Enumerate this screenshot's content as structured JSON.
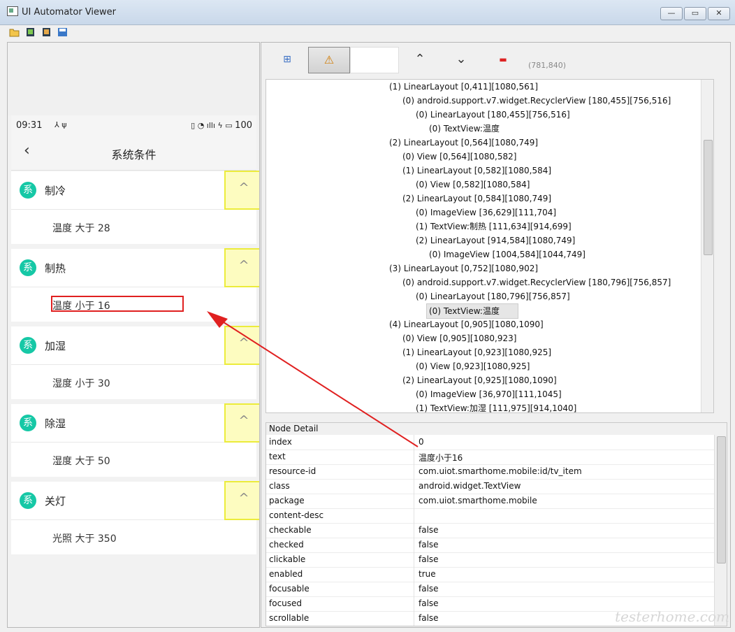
{
  "window": {
    "title": "UI Automator Viewer",
    "minimize": "—",
    "maximize": "▭",
    "close": "✕"
  },
  "toolbar": {
    "icons": [
      "open-folder-icon",
      "device-screenshot-icon",
      "device-screenshot-compressed-icon",
      "save-icon"
    ]
  },
  "phone": {
    "status_time": "09:31",
    "status_icons": "⅄ ψ",
    "status_right": "▯ ◔ ıllı ϟ ▭",
    "battery": "100",
    "back": "‹",
    "page_title": "系统条件",
    "cards": [
      {
        "badge": "系",
        "title": "制冷",
        "body": "温度 大于 28"
      },
      {
        "badge": "系",
        "title": "制热",
        "body": "温度 小于 16"
      },
      {
        "badge": "系",
        "title": "加湿",
        "body": "湿度 小于 30"
      },
      {
        "badge": "系",
        "title": "除湿",
        "body": "湿度 大于 50"
      },
      {
        "badge": "系",
        "title": "关灯",
        "body": "光照 大于 350"
      }
    ],
    "expand_glyph": "^"
  },
  "right": {
    "coords": "(781,840)",
    "tools": {
      "expand": "⊞",
      "warn": "⚠",
      "up": "⌃",
      "down": "⌄",
      "minus": "▬"
    },
    "tree": [
      "(1) LinearLayout [0,411][1080,561]",
      "(0) android.support.v7.widget.RecyclerView [180,455][756,516]",
      "(0) LinearLayout [180,455][756,516]",
      "(0) TextView:温度",
      "(2) LinearLayout [0,564][1080,749]",
      "(0) View [0,564][1080,582]",
      "(1) LinearLayout [0,582][1080,584]",
      "(0) View [0,582][1080,584]",
      "(2) LinearLayout [0,584][1080,749]",
      "(0) ImageView [36,629][111,704]",
      "(1) TextView:制热 [111,634][914,699]",
      "(2) LinearLayout [914,584][1080,749]",
      "(0) ImageView [1004,584][1044,749]",
      "(3) LinearLayout [0,752][1080,902]",
      "(0) android.support.v7.widget.RecyclerView [180,796][756,857]",
      "(0) LinearLayout [180,796][756,857]",
      "(0) TextView:温度",
      "(4) LinearLayout [0,905][1080,1090]",
      "(0) View [0,905][1080,923]",
      "(1) LinearLayout [0,923][1080,925]",
      "(0) View [0,923][1080,925]",
      "(2) LinearLayout [0,925][1080,1090]",
      "(0) ImageView [36,970][111,1045]",
      "(1) TextView:加湿 [111,975][914,1040]"
    ],
    "detail_title": "Node Detail",
    "detail": [
      {
        "key": "index",
        "value": "0"
      },
      {
        "key": "text",
        "value": "温度小于16"
      },
      {
        "key": "resource-id",
        "value": "com.uiot.smarthome.mobile:id/tv_item"
      },
      {
        "key": "class",
        "value": "android.widget.TextView"
      },
      {
        "key": "package",
        "value": "com.uiot.smarthome.mobile"
      },
      {
        "key": "content-desc",
        "value": ""
      },
      {
        "key": "checkable",
        "value": "false"
      },
      {
        "key": "checked",
        "value": "false"
      },
      {
        "key": "clickable",
        "value": "false"
      },
      {
        "key": "enabled",
        "value": "true"
      },
      {
        "key": "focusable",
        "value": "false"
      },
      {
        "key": "focused",
        "value": "false"
      },
      {
        "key": "scrollable",
        "value": "false"
      }
    ]
  },
  "watermark": "testerhome.com",
  "colors": {
    "badge": "#16c8a6",
    "highlight_border": "#ecec3b",
    "highlight_fill": "#fdfcc0",
    "selection_red": "#e02020"
  }
}
